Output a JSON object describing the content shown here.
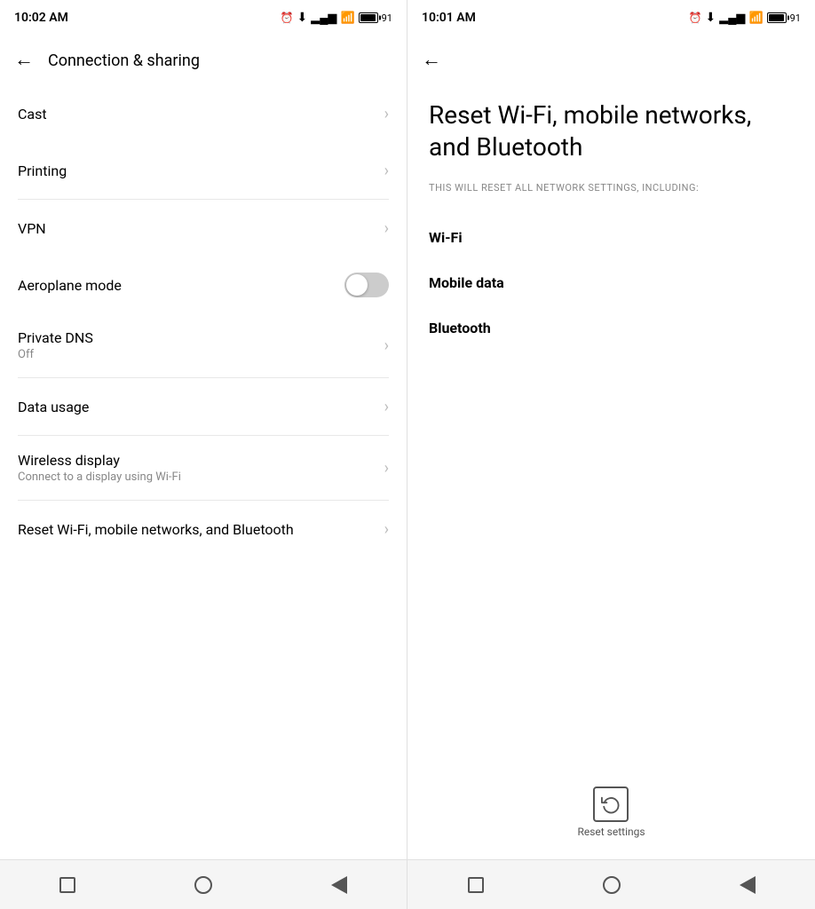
{
  "left": {
    "statusBar": {
      "time": "10:02 AM",
      "batteryPercent": "91"
    },
    "header": {
      "title": "Connection & sharing",
      "backArrow": "←"
    },
    "items": [
      {
        "id": "cast",
        "label": "Cast",
        "sub": "",
        "type": "nav"
      },
      {
        "id": "printing",
        "label": "Printing",
        "sub": "",
        "type": "nav"
      },
      {
        "id": "vpn",
        "label": "VPN",
        "sub": "",
        "type": "nav"
      },
      {
        "id": "aeroplane",
        "label": "Aeroplane mode",
        "sub": "",
        "type": "toggle",
        "toggleOn": false
      },
      {
        "id": "private-dns",
        "label": "Private DNS",
        "sub": "Off",
        "type": "nav"
      },
      {
        "id": "data-usage",
        "label": "Data usage",
        "sub": "",
        "type": "nav"
      },
      {
        "id": "wireless-display",
        "label": "Wireless display",
        "sub": "Connect to a display using Wi-Fi",
        "type": "nav"
      },
      {
        "id": "reset-wifi",
        "label": "Reset Wi-Fi, mobile networks, and Bluetooth",
        "sub": "",
        "type": "nav"
      }
    ],
    "nav": {
      "square": "■",
      "circle": "○",
      "triangle": "◁"
    }
  },
  "right": {
    "statusBar": {
      "time": "10:01 AM",
      "batteryPercent": "91"
    },
    "header": {
      "backArrow": "←"
    },
    "title": "Reset Wi-Fi, mobile networks, and Bluetooth",
    "subtitle": "THIS WILL RESET ALL NETWORK SETTINGS, INCLUDING:",
    "networkItems": [
      {
        "id": "wifi",
        "label": "Wi-Fi"
      },
      {
        "id": "mobile-data",
        "label": "Mobile data"
      },
      {
        "id": "bluetooth",
        "label": "Bluetooth"
      }
    ],
    "resetButton": {
      "label": "Reset settings",
      "icon": "reset-icon"
    },
    "nav": {
      "square": "■",
      "circle": "○",
      "triangle": "◁"
    }
  }
}
